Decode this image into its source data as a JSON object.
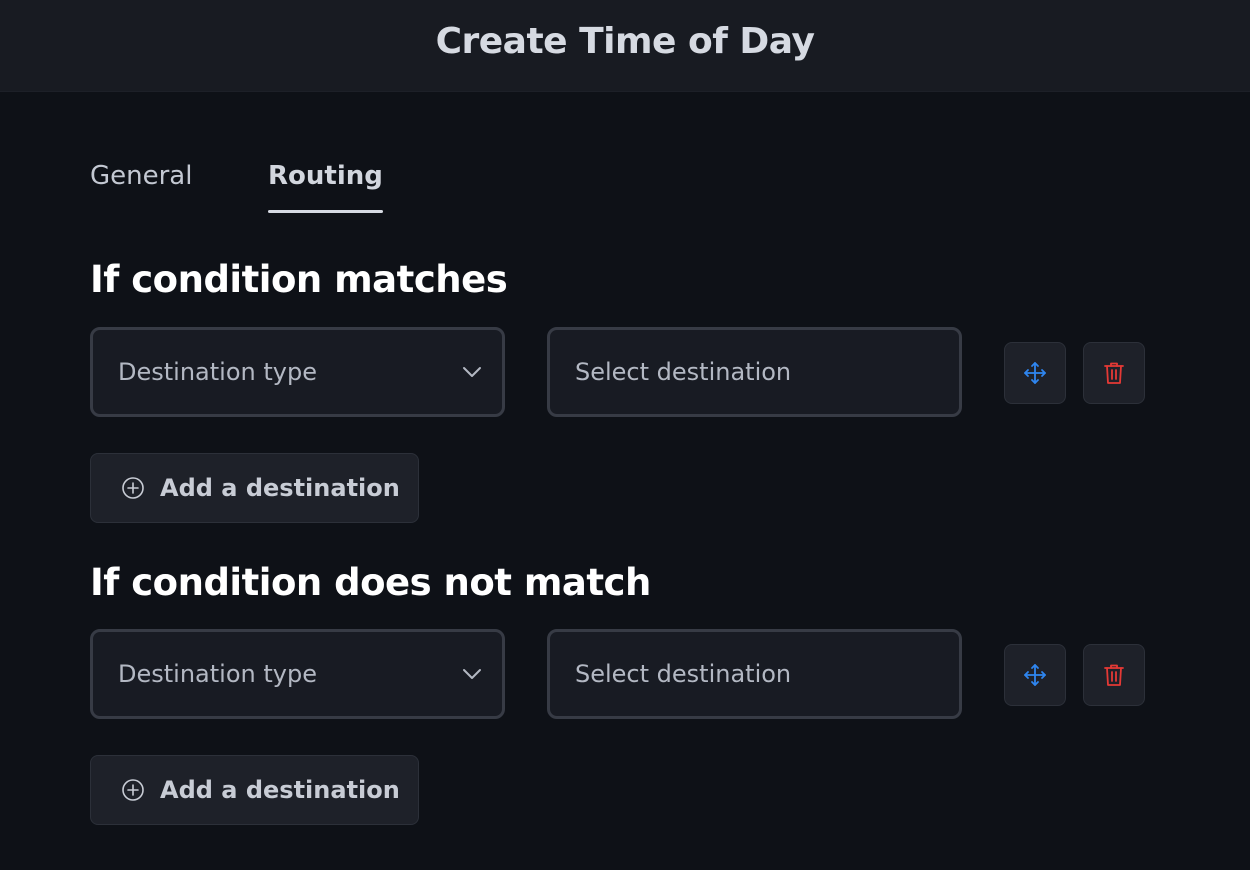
{
  "header": {
    "title": "Create Time of Day"
  },
  "tabs": [
    {
      "label": "General",
      "active": false
    },
    {
      "label": "Routing",
      "active": true
    }
  ],
  "sections": [
    {
      "title": "If condition matches",
      "destination_type_placeholder": "Destination type",
      "select_destination_placeholder": "Select destination",
      "add_label": "Add a destination"
    },
    {
      "title": "If condition does not match",
      "destination_type_placeholder": "Destination type",
      "select_destination_placeholder": "Select destination",
      "add_label": "Add a destination"
    }
  ],
  "icons": {
    "move": "move-arrows-icon",
    "delete": "trash-icon",
    "add": "plus-circle-icon",
    "dropdown": "chevron-down-icon"
  },
  "colors": {
    "move_icon": "#2f86f0",
    "delete_icon": "#e53935",
    "background": "#0e1117",
    "header": "#181b22"
  }
}
